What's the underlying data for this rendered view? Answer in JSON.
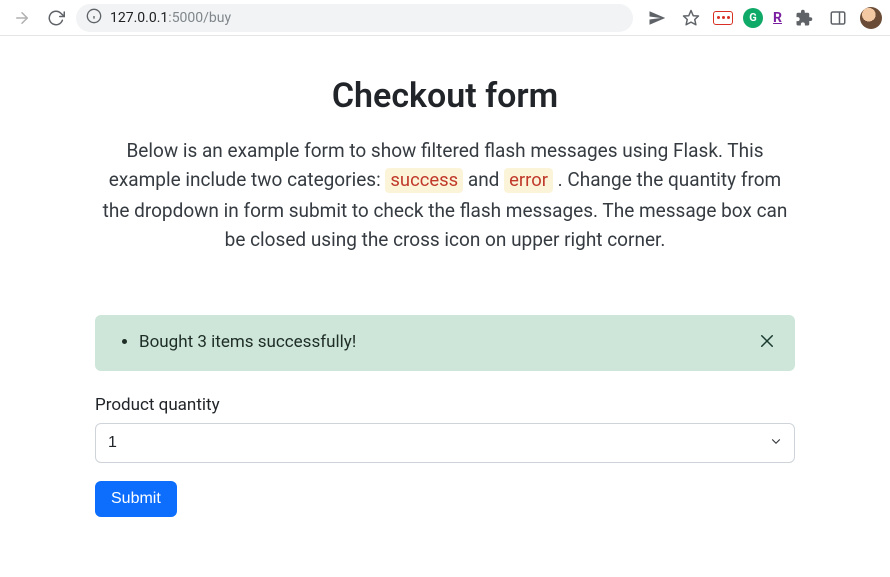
{
  "browser": {
    "url_host": "127.0.0.1",
    "url_port_path": ":5000/buy"
  },
  "page": {
    "title": "Checkout form",
    "lead_part1": "Below is an example form to show filtered flash messages using Flask. This example include two categories: ",
    "lead_code1": "success",
    "lead_mid": " and ",
    "lead_code2": "error",
    "lead_part2": " . Change the quantity from the dropdown in form submit to check the flash messages. The message box can be closed using the cross icon on upper right corner."
  },
  "alert": {
    "type": "success",
    "messages": [
      "Bought 3 items successfully!"
    ]
  },
  "form": {
    "quantity_label": "Product quantity",
    "quantity_value": "1",
    "submit_label": "Submit"
  }
}
